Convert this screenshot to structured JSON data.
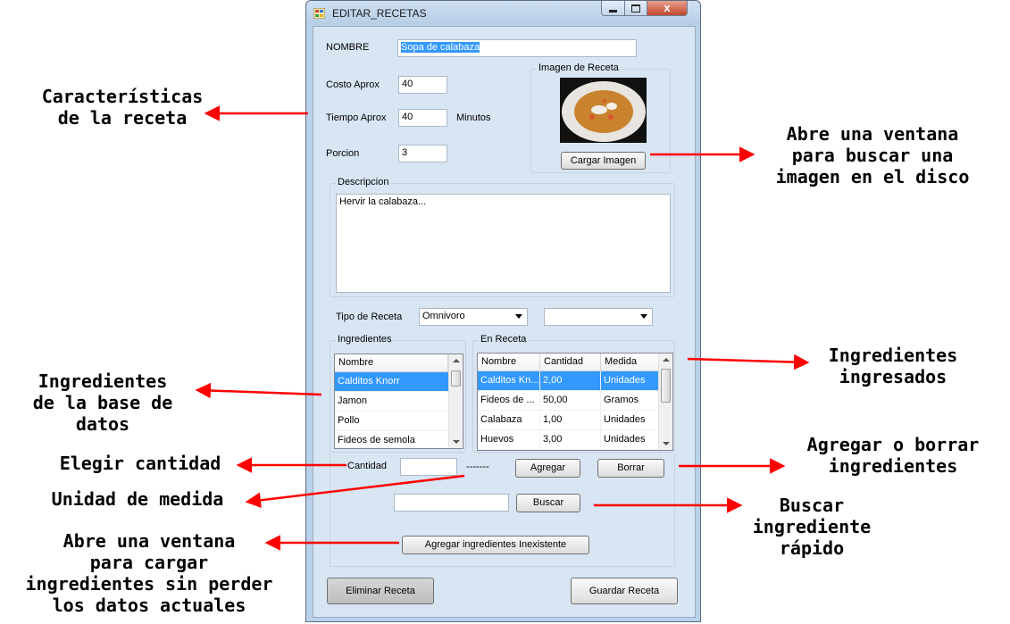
{
  "window": {
    "title": "EDITAR_RECETAS",
    "close_glyph": "x"
  },
  "form": {
    "nombre_label": "NOMBRE",
    "nombre_value": "Sopa de calabaza",
    "costo_label": "Costo Aprox",
    "costo_value": "40",
    "tiempo_label": "Tiempo Aprox",
    "tiempo_value": "40",
    "tiempo_unit": "Minutos",
    "porcion_label": "Porcion",
    "porcion_value": "3",
    "imagen_group_title": "Imagen de Receta",
    "cargar_imagen_button": "Cargar Imagen",
    "descripcion_group_title": "Descripcion",
    "descripcion_value": "Hervir la calabaza...",
    "tipo_label": "Tipo de Receta",
    "tipo_value": "Omnivoro",
    "tipo2_value": "",
    "ingredientes_group_title": "Ingredientes",
    "ingredientes_header": "Nombre",
    "ingredientes_items": [
      "Calditos Knorr",
      "Jamon",
      "Pollo",
      "Fideos de semola"
    ],
    "en_receta_group_title": "En Receta",
    "en_receta_headers": [
      "Nombre",
      "Cantidad",
      "Medida"
    ],
    "en_receta_rows": [
      [
        "Calditos Kn...",
        "2,00",
        "Unidades"
      ],
      [
        "Fideos de ...",
        "50,00",
        "Gramos"
      ],
      [
        "Calabaza",
        "1,00",
        "Unidades"
      ],
      [
        "Huevos",
        "3,00",
        "Unidades"
      ]
    ],
    "cantidad_label": "Cantidad",
    "cantidad_value": "",
    "medida_placeholder": "-------",
    "agregar_button": "Agregar",
    "borrar_button": "Borrar",
    "buscar_value": "",
    "buscar_button": "Buscar",
    "agregar_inexistente_button": "Agregar ingredientes Inexistente",
    "eliminar_button": "Eliminar Receta",
    "guardar_button": "Guardar Receta"
  },
  "annotations": {
    "caracteristicas": "Características\nde la receta",
    "abre_imagen": "Abre una ventana\npara buscar una\nimagen en el disco",
    "ingredientes_base": "Ingredientes\nde la base de\ndatos",
    "ingredientes_ingresados": "Ingredientes\ningresados",
    "elegir_cantidad": "Elegir cantidad",
    "unidad_medida": "Unidad de medida",
    "agregar_borrar": "Agregar o borrar\ningredientes",
    "buscar_rapido": "Buscar\ningrediente\nrápido",
    "abre_cargar": "Abre una ventana\npara cargar\ningredientes sin perder\nlos datos actuales"
  },
  "colors": {
    "arrow": "#ff0000",
    "selection": "#3399ff",
    "window_bg": "#d8e5f2"
  }
}
